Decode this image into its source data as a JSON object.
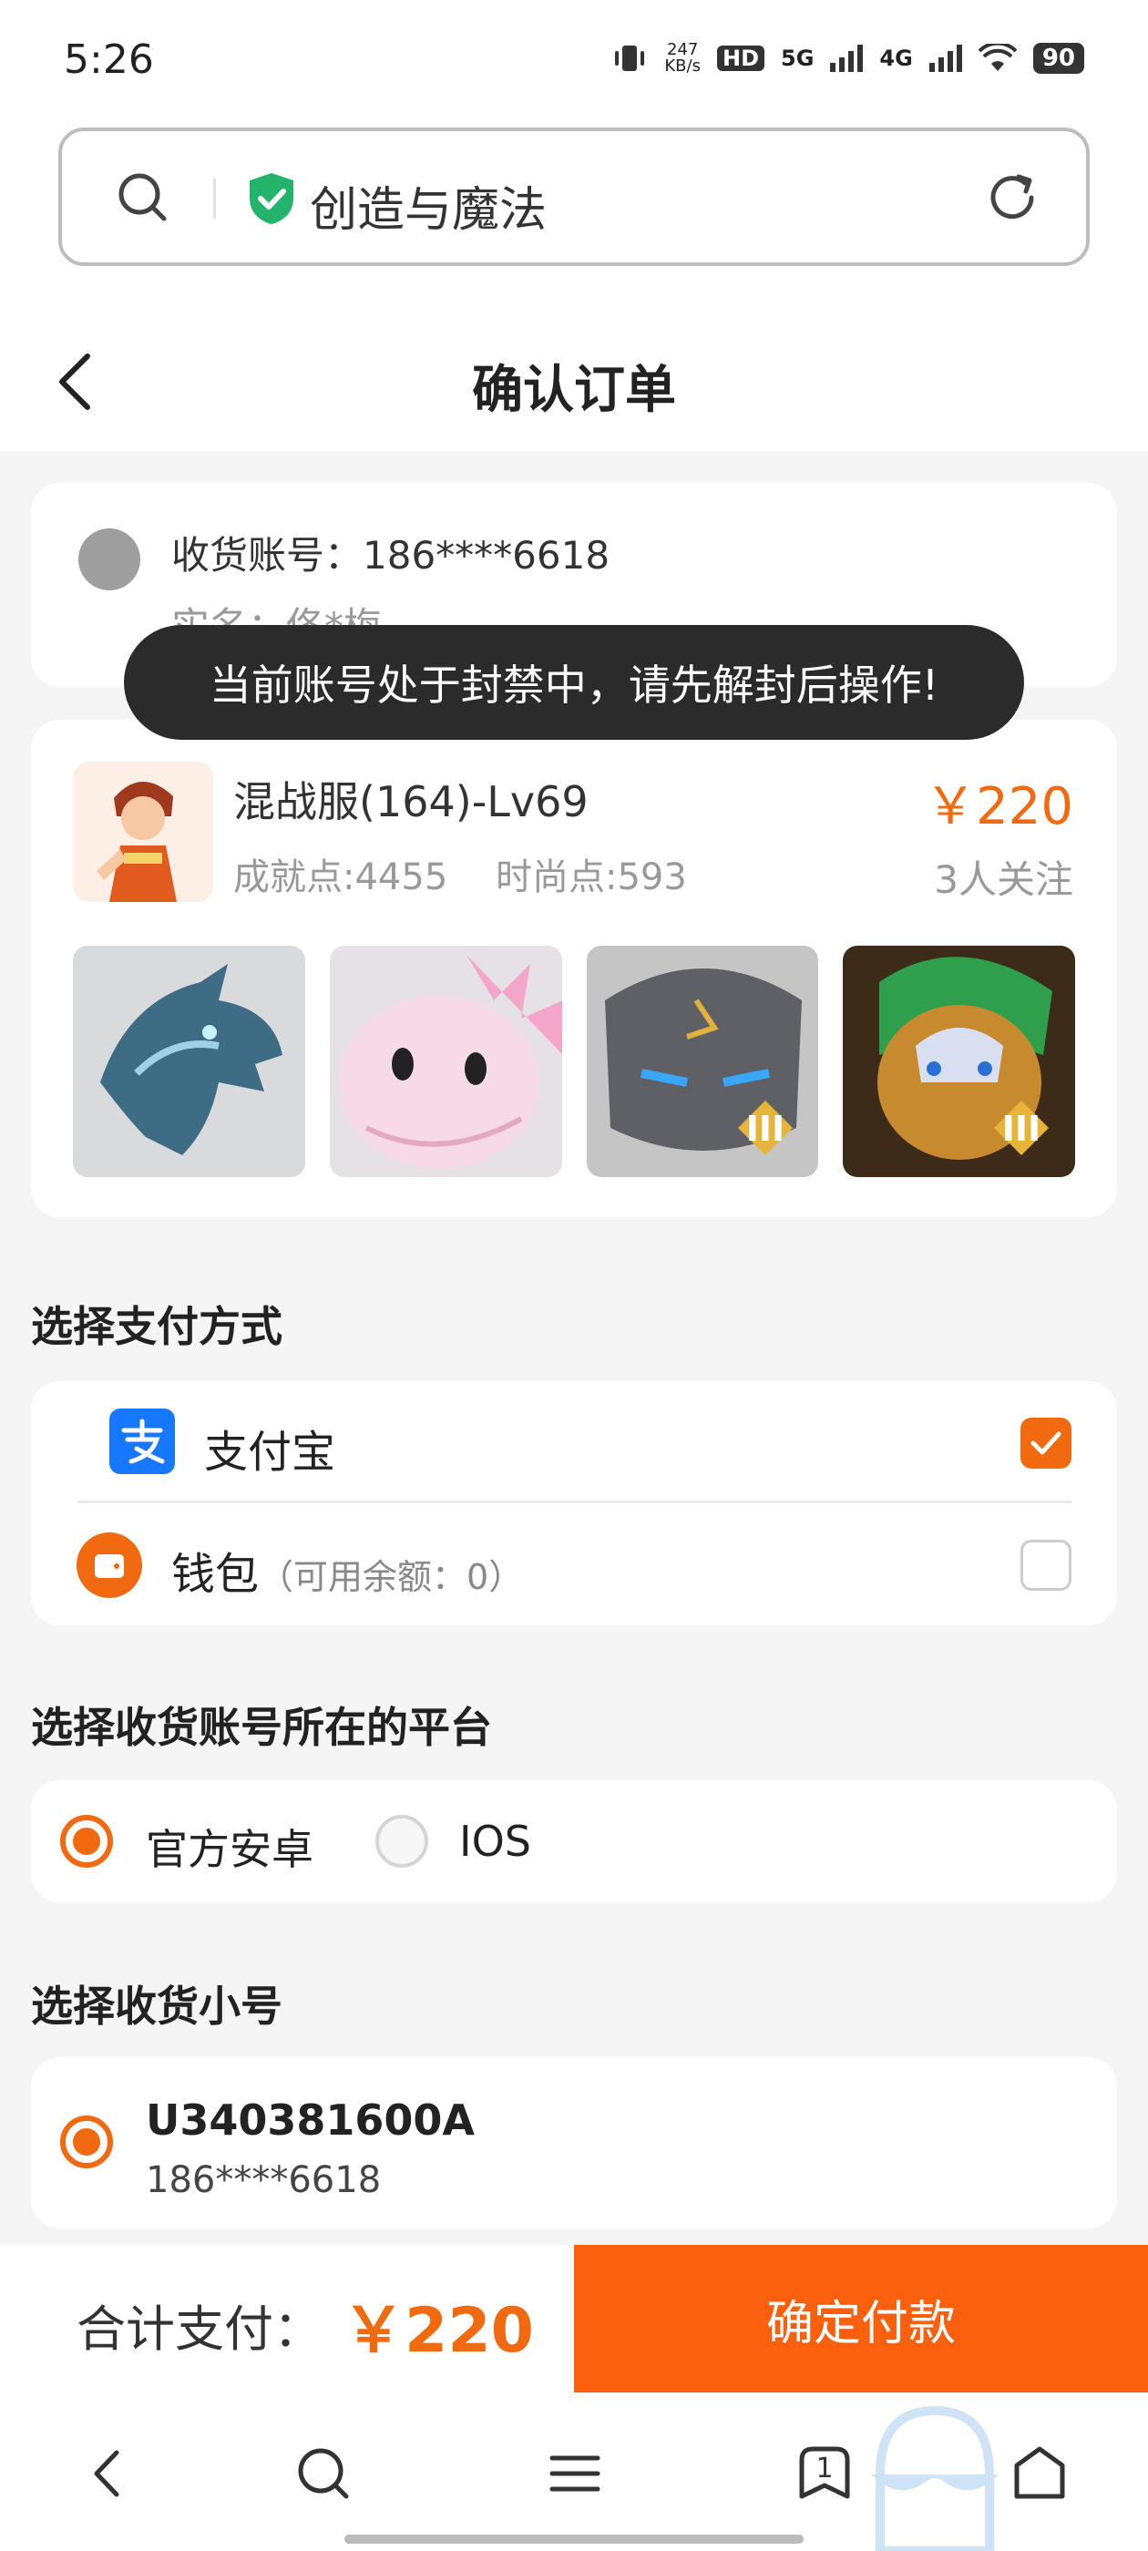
{
  "status_bar": {
    "time": "5:26",
    "net_speed_value": "247",
    "net_speed_unit": "KB/s",
    "hd": "HD",
    "signal1": "5G",
    "signal2": "4G",
    "battery": "90"
  },
  "browser": {
    "site_title": "创造与魔法"
  },
  "header": {
    "title": "确认订单"
  },
  "account": {
    "account_line": "收货账号：186****6618",
    "realname_line": "实名：佟*梅"
  },
  "toast": {
    "message": "当前账号处于封禁中，请先解封后操作!"
  },
  "game": {
    "name": "混战服(164)-Lv69",
    "achievement": "成就点:4455",
    "fashion": "时尚点:593",
    "price": "￥220",
    "followers": "3人关注",
    "badge_tier": "III"
  },
  "payment": {
    "section_title": "选择支付方式",
    "methods": [
      {
        "label": "支付宝",
        "sub": "",
        "checked": true
      },
      {
        "label": "钱包",
        "sub": "（可用余额：0）",
        "checked": false
      }
    ]
  },
  "platform": {
    "section_title": "选择收货账号所在的平台",
    "options": [
      {
        "label": "官方安卓",
        "selected": true
      },
      {
        "label": "IOS",
        "selected": false
      }
    ]
  },
  "sub_account": {
    "section_title": "选择收货小号",
    "id": "U340381600A",
    "phone": "186****6618"
  },
  "pay_bar": {
    "total_label": "合计支付：",
    "total": "￥220",
    "confirm": "确定付款"
  },
  "nav": {
    "tabs_count": "1"
  },
  "colors": {
    "accent": "#f26a0f",
    "confirm_bg": "#fa5f0c",
    "alipay": "#1677ff",
    "toast_bg": "#2b2b2b"
  }
}
